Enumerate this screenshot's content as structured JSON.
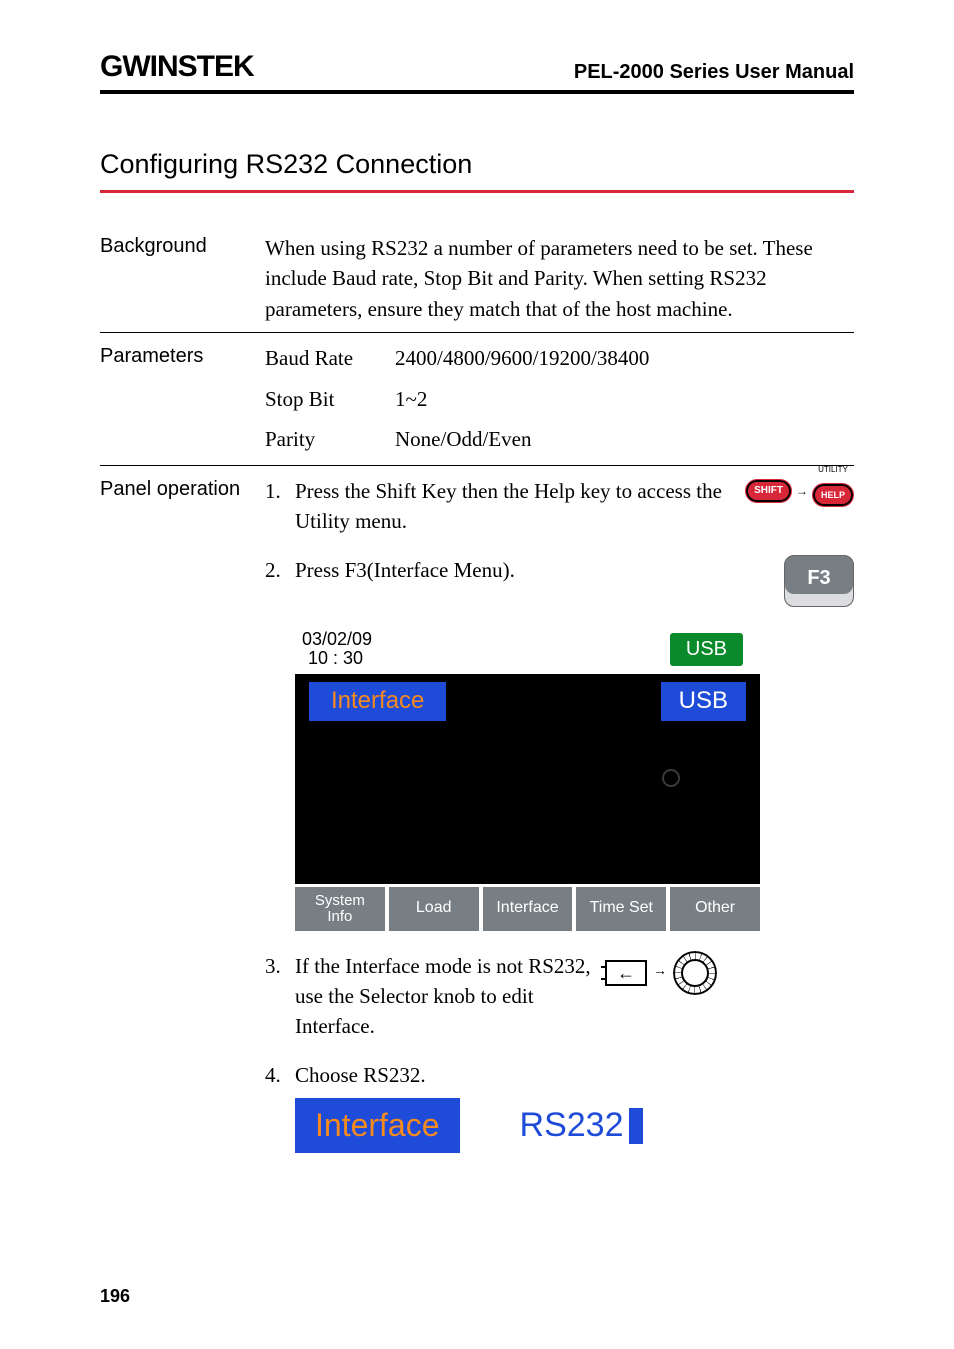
{
  "header": {
    "brand": "GWINSTEK",
    "doc_title": "PEL-2000 Series User Manual"
  },
  "section_heading": "Configuring RS232 Connection",
  "background": {
    "label": "Background",
    "text": "When using RS232 a number of parameters need to be set. These include Baud rate, Stop Bit and Parity. When setting RS232 parameters, ensure they match that of the host machine."
  },
  "parameters": {
    "label": "Parameters",
    "rows": [
      {
        "name": "Baud Rate",
        "value": "2400/4800/9600/19200/38400"
      },
      {
        "name": "Stop Bit",
        "value": "1~2"
      },
      {
        "name": "Parity",
        "value": "None/Odd/Even"
      }
    ]
  },
  "panel_operation": {
    "label": "Panel operation",
    "steps": {
      "s1": {
        "num": "1.",
        "text": "Press the Shift Key then the Help key to access the Utility menu."
      },
      "s2": {
        "num": "2.",
        "text": "Press F3(Interface Menu)."
      },
      "s3": {
        "num": "3.",
        "text": "If the Interface mode is not RS232, use the Selector knob to edit Interface."
      },
      "s4": {
        "num": "4.",
        "text": "Choose RS232."
      }
    },
    "keys": {
      "shift": "SHIFT",
      "help": "HELP",
      "help_super": "UTILITY",
      "f3": "F3"
    }
  },
  "screen": {
    "datetime_date": "03/02/09",
    "datetime_time": "10 : 30",
    "usb_pill": "USB",
    "interface_label": "Interface",
    "interface_value": "USB",
    "tabs": {
      "system_info_l1": "System",
      "system_info_l2": "Info",
      "load": "Load",
      "interface": "Interface",
      "time_set": "Time Set",
      "other": "Other"
    }
  },
  "big_row": {
    "interface": "Interface",
    "rs232": "RS232"
  },
  "selector_arrow_in": "←",
  "selector_arrow_to": "→",
  "page_number": "196"
}
